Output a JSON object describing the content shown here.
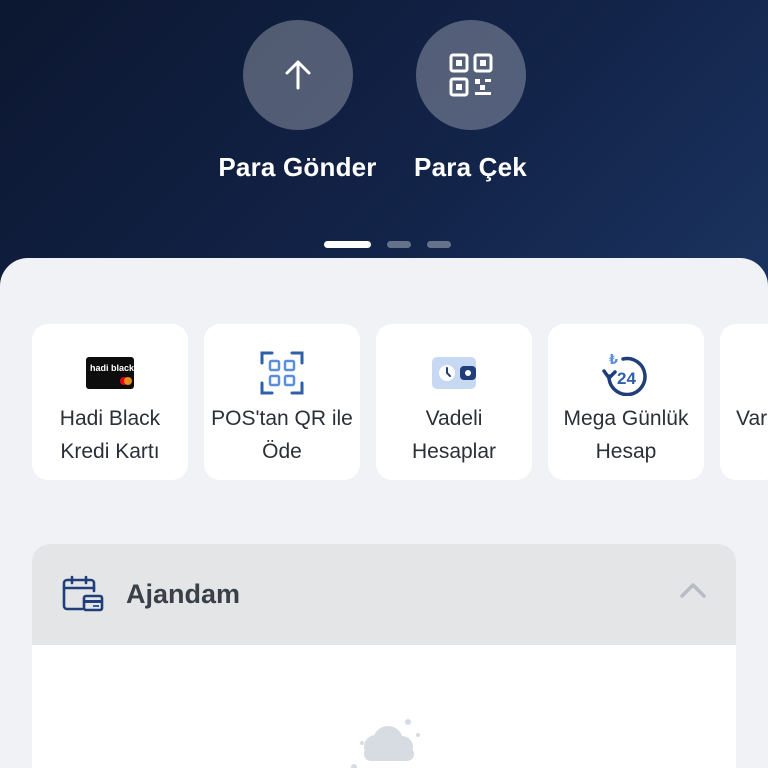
{
  "quick_actions": [
    {
      "label": "Para Gönder",
      "icon": "arrow-up-icon"
    },
    {
      "label": "Para Çek",
      "icon": "qr-code-icon"
    }
  ],
  "pager": {
    "total": 3,
    "active": 0
  },
  "shortcuts": [
    {
      "label": "Hadi Black\nKredi Kartı",
      "icon": "credit-card-icon",
      "card_text": "hadi black"
    },
    {
      "label": "POS'tan QR ile\nÖde",
      "icon": "qr-scan-icon"
    },
    {
      "label": "Vadeli\nHesaplar",
      "icon": "wallet-clock-icon"
    },
    {
      "label": "Mega Günlük\nHesap",
      "icon": "lira-24-icon",
      "badge_text": "24"
    },
    {
      "label": "Var",
      "icon": ""
    }
  ],
  "agenda": {
    "title": "Ajandam",
    "icon": "calendar-card-icon",
    "expanded": true
  },
  "colors": {
    "accent_blue": "#3b6fc4",
    "sheet_bg": "#f1f2f5",
    "hero_dark": "#0c1730"
  }
}
